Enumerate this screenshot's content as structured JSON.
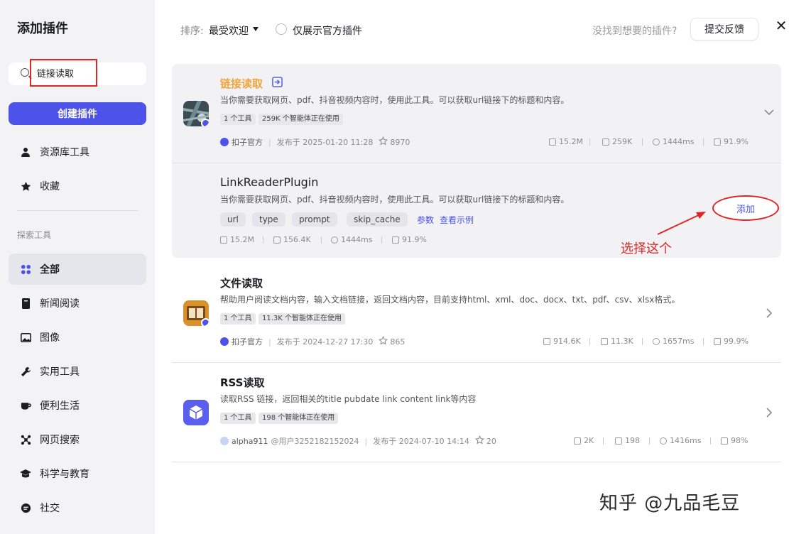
{
  "sidebar": {
    "title": "添加插件",
    "search_value": "链接读取",
    "create_label": "创建插件",
    "top_items": [
      {
        "label": "资源库工具",
        "icon": "person-icon"
      },
      {
        "label": "收藏",
        "icon": "star-icon"
      }
    ],
    "section_label": "探索工具",
    "items": [
      {
        "label": "全部",
        "icon": "grid-icon"
      },
      {
        "label": "新闻阅读",
        "icon": "book-icon"
      },
      {
        "label": "图像",
        "icon": "image-icon"
      },
      {
        "label": "实用工具",
        "icon": "wrench-icon"
      },
      {
        "label": "便利生活",
        "icon": "cup-icon"
      },
      {
        "label": "网页搜索",
        "icon": "network-icon"
      },
      {
        "label": "科学与教育",
        "icon": "graduation-cap-icon"
      },
      {
        "label": "社交",
        "icon": "chat-icon"
      }
    ]
  },
  "header": {
    "sort_label": "排序:",
    "sort_value": "最受欢迎",
    "official_only": "仅展示官方插件",
    "not_found": "没找到想要的插件?",
    "feedback": "提交反馈",
    "close": "✕"
  },
  "plugins": [
    {
      "title": "链接读取",
      "desc": "当你需要获取网页、pdf、抖音视频内容时，使用此工具。可以获取url链接下的标题和内容。",
      "tag1": "1 个工具",
      "tag2": "259K 个智能体正在使用",
      "author": "扣子官方",
      "published": "发布于 2025-01-20 11:28",
      "stars": "8970",
      "stat1": "15.2M",
      "stat2": "259K",
      "stat3": "1444ms",
      "stat4": "91.9%"
    },
    {
      "title": "文件读取",
      "desc": "帮助用户阅读文档内容，输入文档链接，返回文档内容，目前支持html、xml、doc、docx、txt、pdf、csv、xlsx格式。",
      "tag1": "1 个工具",
      "tag2": "11.3K 个智能体正在使用",
      "author": "扣子官方",
      "published": "发布于 2024-12-27 17:30",
      "stars": "865",
      "stat1": "914.6K",
      "stat2": "11.3K",
      "stat3": "1657ms",
      "stat4": "99.9%"
    },
    {
      "title": "RSS读取",
      "desc": "读取RSS 链接，返回相关的title pubdate link content link等内容",
      "tag1": "1 个工具",
      "tag2": "198 个智能体正在使用",
      "author": "alpha911",
      "user": "@用户3252182152024",
      "published": "发布于 2024-07-10 14:14",
      "stars": "20",
      "stat1": "2K",
      "stat2": "198",
      "stat3": "1416ms",
      "stat4": "98%"
    }
  ],
  "tool": {
    "title": "LinkReaderPlugin",
    "desc": "当你需要获取网页、pdf、抖音视频内容时，使用此工具。可以获取url链接下的标题和内容。",
    "params": [
      "url",
      "type",
      "prompt",
      "skip_cache"
    ],
    "params_link": "参数",
    "example_link": "查看示例",
    "stat1": "15.2M",
    "stat2": "156.4K",
    "stat3": "1444ms",
    "stat4": "91.9%",
    "add_label": "添加"
  },
  "annotation": "选择这个",
  "watermark": "知乎 @九品毛豆",
  "colors": {
    "accent": "#4d53e8",
    "highlight": "#e02525",
    "orange": "#f0a33a"
  }
}
